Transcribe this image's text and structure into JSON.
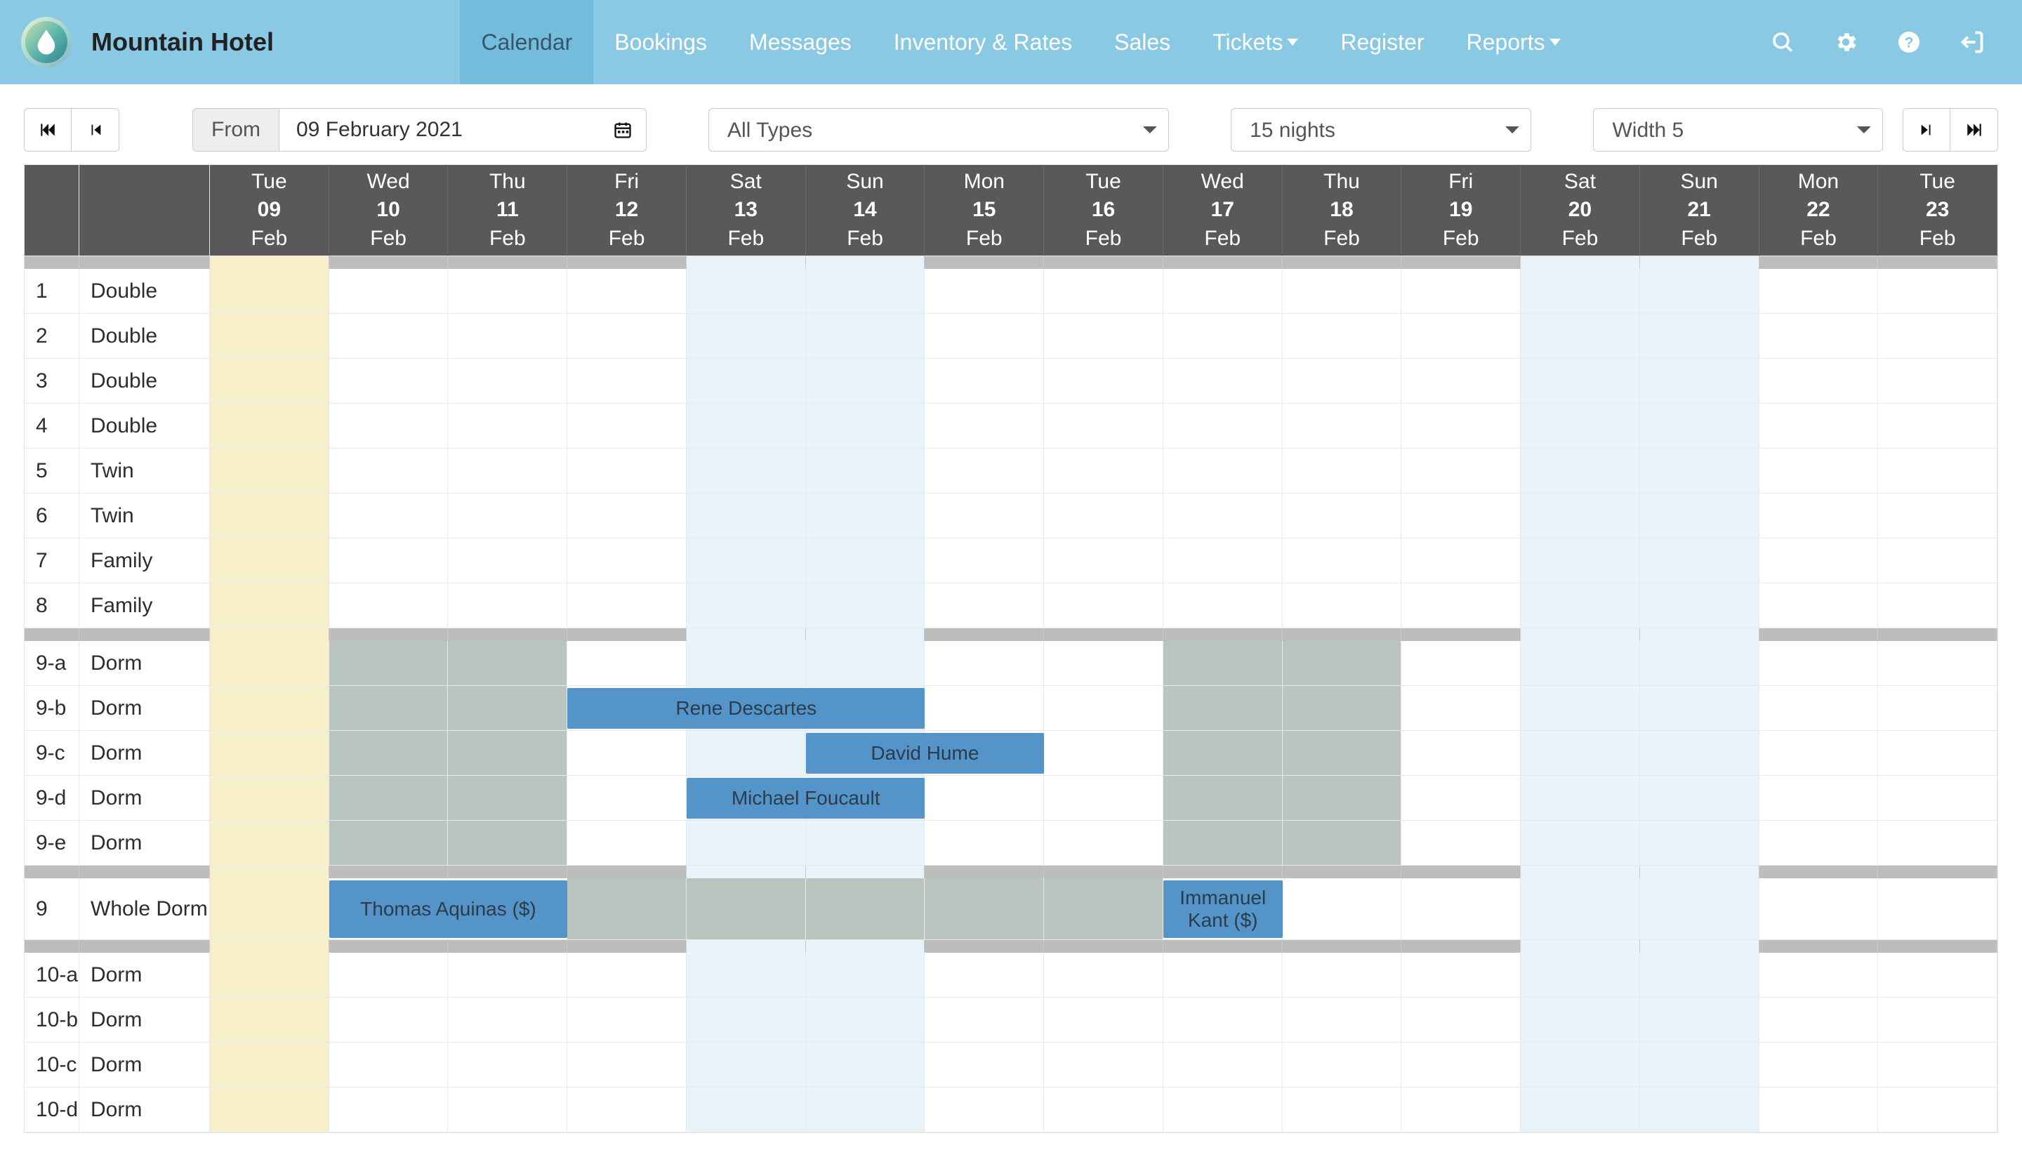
{
  "app": {
    "brand": "Mountain Hotel"
  },
  "nav": {
    "items": [
      {
        "label": "Calendar",
        "active": true,
        "dropdown": false
      },
      {
        "label": "Bookings",
        "active": false,
        "dropdown": false
      },
      {
        "label": "Messages",
        "active": false,
        "dropdown": false
      },
      {
        "label": "Inventory & Rates",
        "active": false,
        "dropdown": false
      },
      {
        "label": "Sales",
        "active": false,
        "dropdown": false
      },
      {
        "label": "Tickets",
        "active": false,
        "dropdown": true
      },
      {
        "label": "Register",
        "active": false,
        "dropdown": false
      },
      {
        "label": "Reports",
        "active": false,
        "dropdown": true
      }
    ]
  },
  "toolbar": {
    "from_label": "From",
    "date_value": "09 February 2021",
    "type_select": "All Types",
    "nights_select": "15 nights",
    "width_select": "Width 5"
  },
  "calendar": {
    "days": [
      {
        "dow": "Tue",
        "dd": "09",
        "mon": "Feb",
        "today": true,
        "weekend": false
      },
      {
        "dow": "Wed",
        "dd": "10",
        "mon": "Feb",
        "today": false,
        "weekend": false
      },
      {
        "dow": "Thu",
        "dd": "11",
        "mon": "Feb",
        "today": false,
        "weekend": false
      },
      {
        "dow": "Fri",
        "dd": "12",
        "mon": "Feb",
        "today": false,
        "weekend": false
      },
      {
        "dow": "Sat",
        "dd": "13",
        "mon": "Feb",
        "today": false,
        "weekend": true
      },
      {
        "dow": "Sun",
        "dd": "14",
        "mon": "Feb",
        "today": false,
        "weekend": true
      },
      {
        "dow": "Mon",
        "dd": "15",
        "mon": "Feb",
        "today": false,
        "weekend": false
      },
      {
        "dow": "Tue",
        "dd": "16",
        "mon": "Feb",
        "today": false,
        "weekend": false
      },
      {
        "dow": "Wed",
        "dd": "17",
        "mon": "Feb",
        "today": false,
        "weekend": false
      },
      {
        "dow": "Thu",
        "dd": "18",
        "mon": "Feb",
        "today": false,
        "weekend": false
      },
      {
        "dow": "Fri",
        "dd": "19",
        "mon": "Feb",
        "today": false,
        "weekend": false
      },
      {
        "dow": "Sat",
        "dd": "20",
        "mon": "Feb",
        "today": false,
        "weekend": true
      },
      {
        "dow": "Sun",
        "dd": "21",
        "mon": "Feb",
        "today": false,
        "weekend": true
      },
      {
        "dow": "Mon",
        "dd": "22",
        "mon": "Feb",
        "today": false,
        "weekend": false
      },
      {
        "dow": "Tue",
        "dd": "23",
        "mon": "Feb",
        "today": false,
        "weekend": false
      }
    ],
    "rows": [
      {
        "num": "1",
        "name": "Double",
        "tall": false,
        "blocked": [],
        "bookings": []
      },
      {
        "num": "2",
        "name": "Double",
        "tall": false,
        "blocked": [],
        "bookings": []
      },
      {
        "num": "3",
        "name": "Double",
        "tall": false,
        "blocked": [],
        "bookings": []
      },
      {
        "num": "4",
        "name": "Double",
        "tall": false,
        "blocked": [],
        "bookings": []
      },
      {
        "num": "5",
        "name": "Twin",
        "tall": false,
        "blocked": [],
        "bookings": []
      },
      {
        "num": "6",
        "name": "Twin",
        "tall": false,
        "blocked": [],
        "bookings": []
      },
      {
        "num": "7",
        "name": "Family",
        "tall": false,
        "blocked": [],
        "bookings": []
      },
      {
        "num": "8",
        "name": "Family",
        "tall": false,
        "blocked": [],
        "bookings": []
      },
      {
        "num": "9-a",
        "name": "Dorm",
        "tall": false,
        "blocked": [
          1,
          2,
          8,
          9
        ],
        "bookings": []
      },
      {
        "num": "9-b",
        "name": "Dorm",
        "tall": false,
        "blocked": [
          1,
          2,
          8,
          9
        ],
        "bookings": [
          {
            "label": "Rene Descartes",
            "start": 3,
            "span": 3
          }
        ]
      },
      {
        "num": "9-c",
        "name": "Dorm",
        "tall": false,
        "blocked": [
          1,
          2,
          8,
          9
        ],
        "bookings": [
          {
            "label": "David Hume",
            "start": 5,
            "span": 2
          }
        ]
      },
      {
        "num": "9-d",
        "name": "Dorm",
        "tall": false,
        "blocked": [
          1,
          2,
          8,
          9
        ],
        "bookings": [
          {
            "label": "Michael Foucault",
            "start": 4,
            "span": 2
          }
        ]
      },
      {
        "num": "9-e",
        "name": "Dorm",
        "tall": false,
        "blocked": [
          1,
          2,
          8,
          9
        ],
        "bookings": []
      },
      {
        "num": "9",
        "name": "Whole Dorm",
        "tall": true,
        "blocked": [
          3,
          4,
          5,
          6,
          7
        ],
        "bookings": [
          {
            "label": "Thomas Aquinas ($)",
            "start": 1,
            "span": 2
          },
          {
            "label": "Immanuel Kant ($)",
            "start": 8,
            "span": 1
          }
        ]
      },
      {
        "num": "10-a",
        "name": "Dorm",
        "tall": false,
        "blocked": [],
        "bookings": []
      },
      {
        "num": "10-b",
        "name": "Dorm",
        "tall": false,
        "blocked": [],
        "bookings": []
      },
      {
        "num": "10-c",
        "name": "Dorm",
        "tall": false,
        "blocked": [],
        "bookings": []
      },
      {
        "num": "10-d",
        "name": "Dorm",
        "tall": false,
        "blocked": [],
        "bookings": []
      }
    ]
  }
}
